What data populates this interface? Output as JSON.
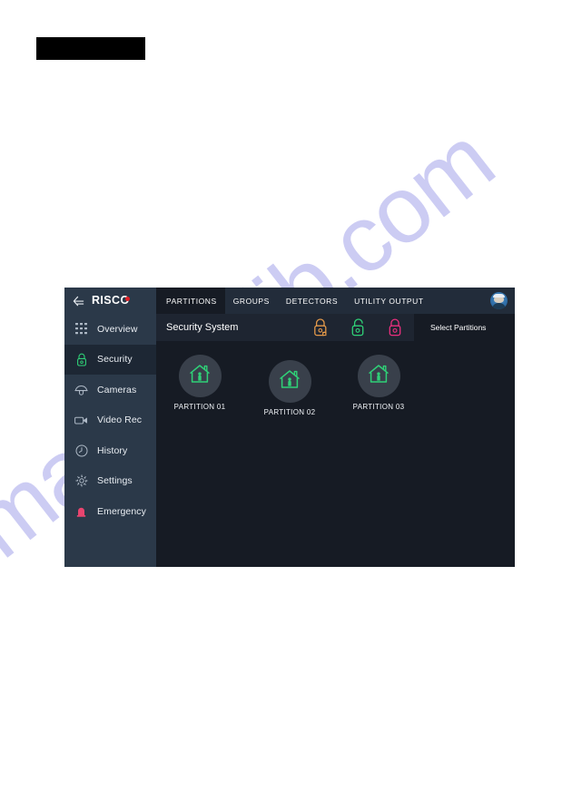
{
  "page": {
    "background": "#ffffff",
    "watermark_text": "manualslib.com",
    "watermark_color": "#b9b9ef"
  },
  "redaction": {
    "label": "redacted-black-bar",
    "color": "#000000"
  },
  "app": {
    "theme": {
      "window_bg": "#161b24",
      "sidebar_bg": "#2b3949",
      "tabbar_bg": "#222c3a",
      "active_nav_bg": "#1d2734",
      "status_row_bg": "#1e2531",
      "circle_bg": "#39404b",
      "accent_green": "#2fd177",
      "accent_orange": "#e3994a",
      "accent_pink": "#ea2f7e",
      "brand_red": "#e01f26",
      "text_primary": "#ffffff",
      "text_secondary": "#e9edf2"
    },
    "sidebar": {
      "back_icon": "back-arrow-icon",
      "brand": {
        "text_before": "RISC",
        "text_o": "O",
        "dot_color": "#e01f26"
      },
      "items": [
        {
          "label": "Overview",
          "icon": "grid-keypad-icon",
          "active": false
        },
        {
          "label": "Security",
          "icon": "lock-icon",
          "active": true
        },
        {
          "label": "Cameras",
          "icon": "dome-camera-icon",
          "active": false
        },
        {
          "label": "Video Rec",
          "icon": "video-camera-icon",
          "active": false
        },
        {
          "label": "History",
          "icon": "clock-history-icon",
          "active": false
        },
        {
          "label": "Settings",
          "icon": "gear-icon",
          "active": false
        },
        {
          "label": "Emergency",
          "icon": "siren-icon",
          "active": false
        }
      ]
    },
    "tabs": [
      {
        "label": "PARTITIONS",
        "active": true
      },
      {
        "label": "GROUPS",
        "active": false
      },
      {
        "label": "DETECTORS",
        "active": false
      },
      {
        "label": "UTILITY OUTPUT",
        "active": false
      }
    ],
    "avatar": {
      "icon": "user-avatar-icon"
    },
    "status_row": {
      "system_title": "Security System",
      "select_partitions_label": "Select Partitions",
      "locks": [
        {
          "name": "partial-arm-lock-icon",
          "state": "closed-partial",
          "color": "#e3994a"
        },
        {
          "name": "disarmed-lock-icon",
          "state": "open",
          "color": "#2fd177"
        },
        {
          "name": "armed-lock-icon",
          "state": "closed",
          "color": "#ea2f7e"
        }
      ]
    },
    "partitions": [
      {
        "label": "PARTITION 01",
        "icon": "home-person-icon",
        "icon_color": "#2fd177"
      },
      {
        "label": "PARTITION 02",
        "icon": "home-person-icon",
        "icon_color": "#2fd177"
      },
      {
        "label": "PARTITION 03",
        "icon": "home-person-icon",
        "icon_color": "#2fd177"
      }
    ]
  }
}
